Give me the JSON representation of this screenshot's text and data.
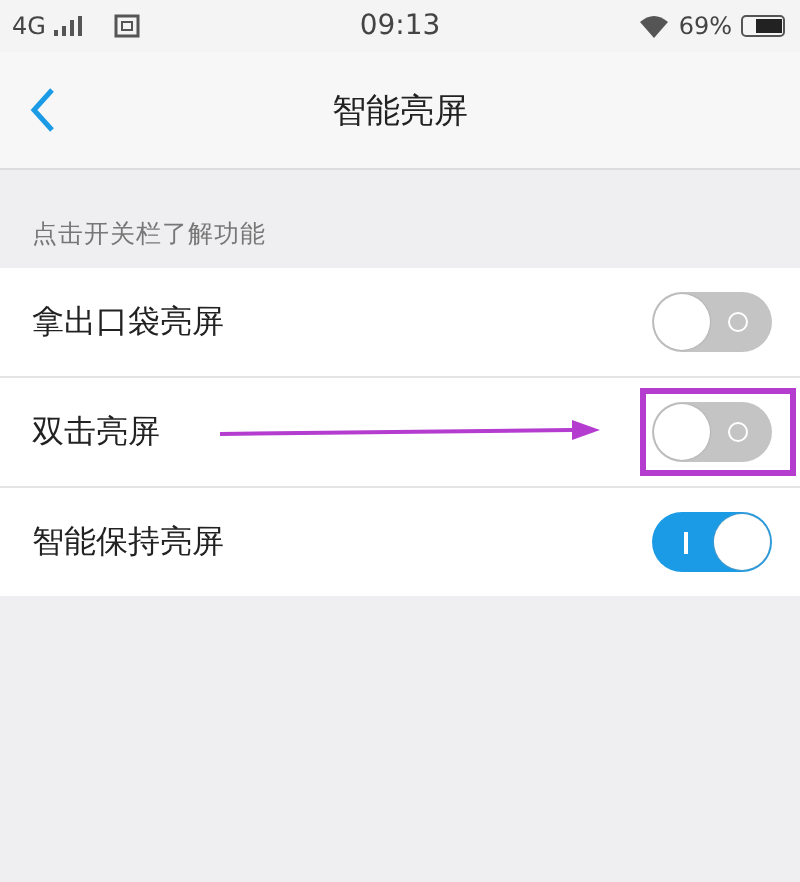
{
  "status_bar": {
    "network": "4G",
    "time": "09:13",
    "battery": "69%"
  },
  "nav_bar": {
    "title": "智能亮屏"
  },
  "section_header": "点击开关栏了解功能",
  "settings": [
    {
      "label": "拿出口袋亮屏",
      "on": false,
      "annotated": false
    },
    {
      "label": "双击亮屏",
      "on": false,
      "annotated": true
    },
    {
      "label": "智能保持亮屏",
      "on": true,
      "annotated": false
    }
  ]
}
